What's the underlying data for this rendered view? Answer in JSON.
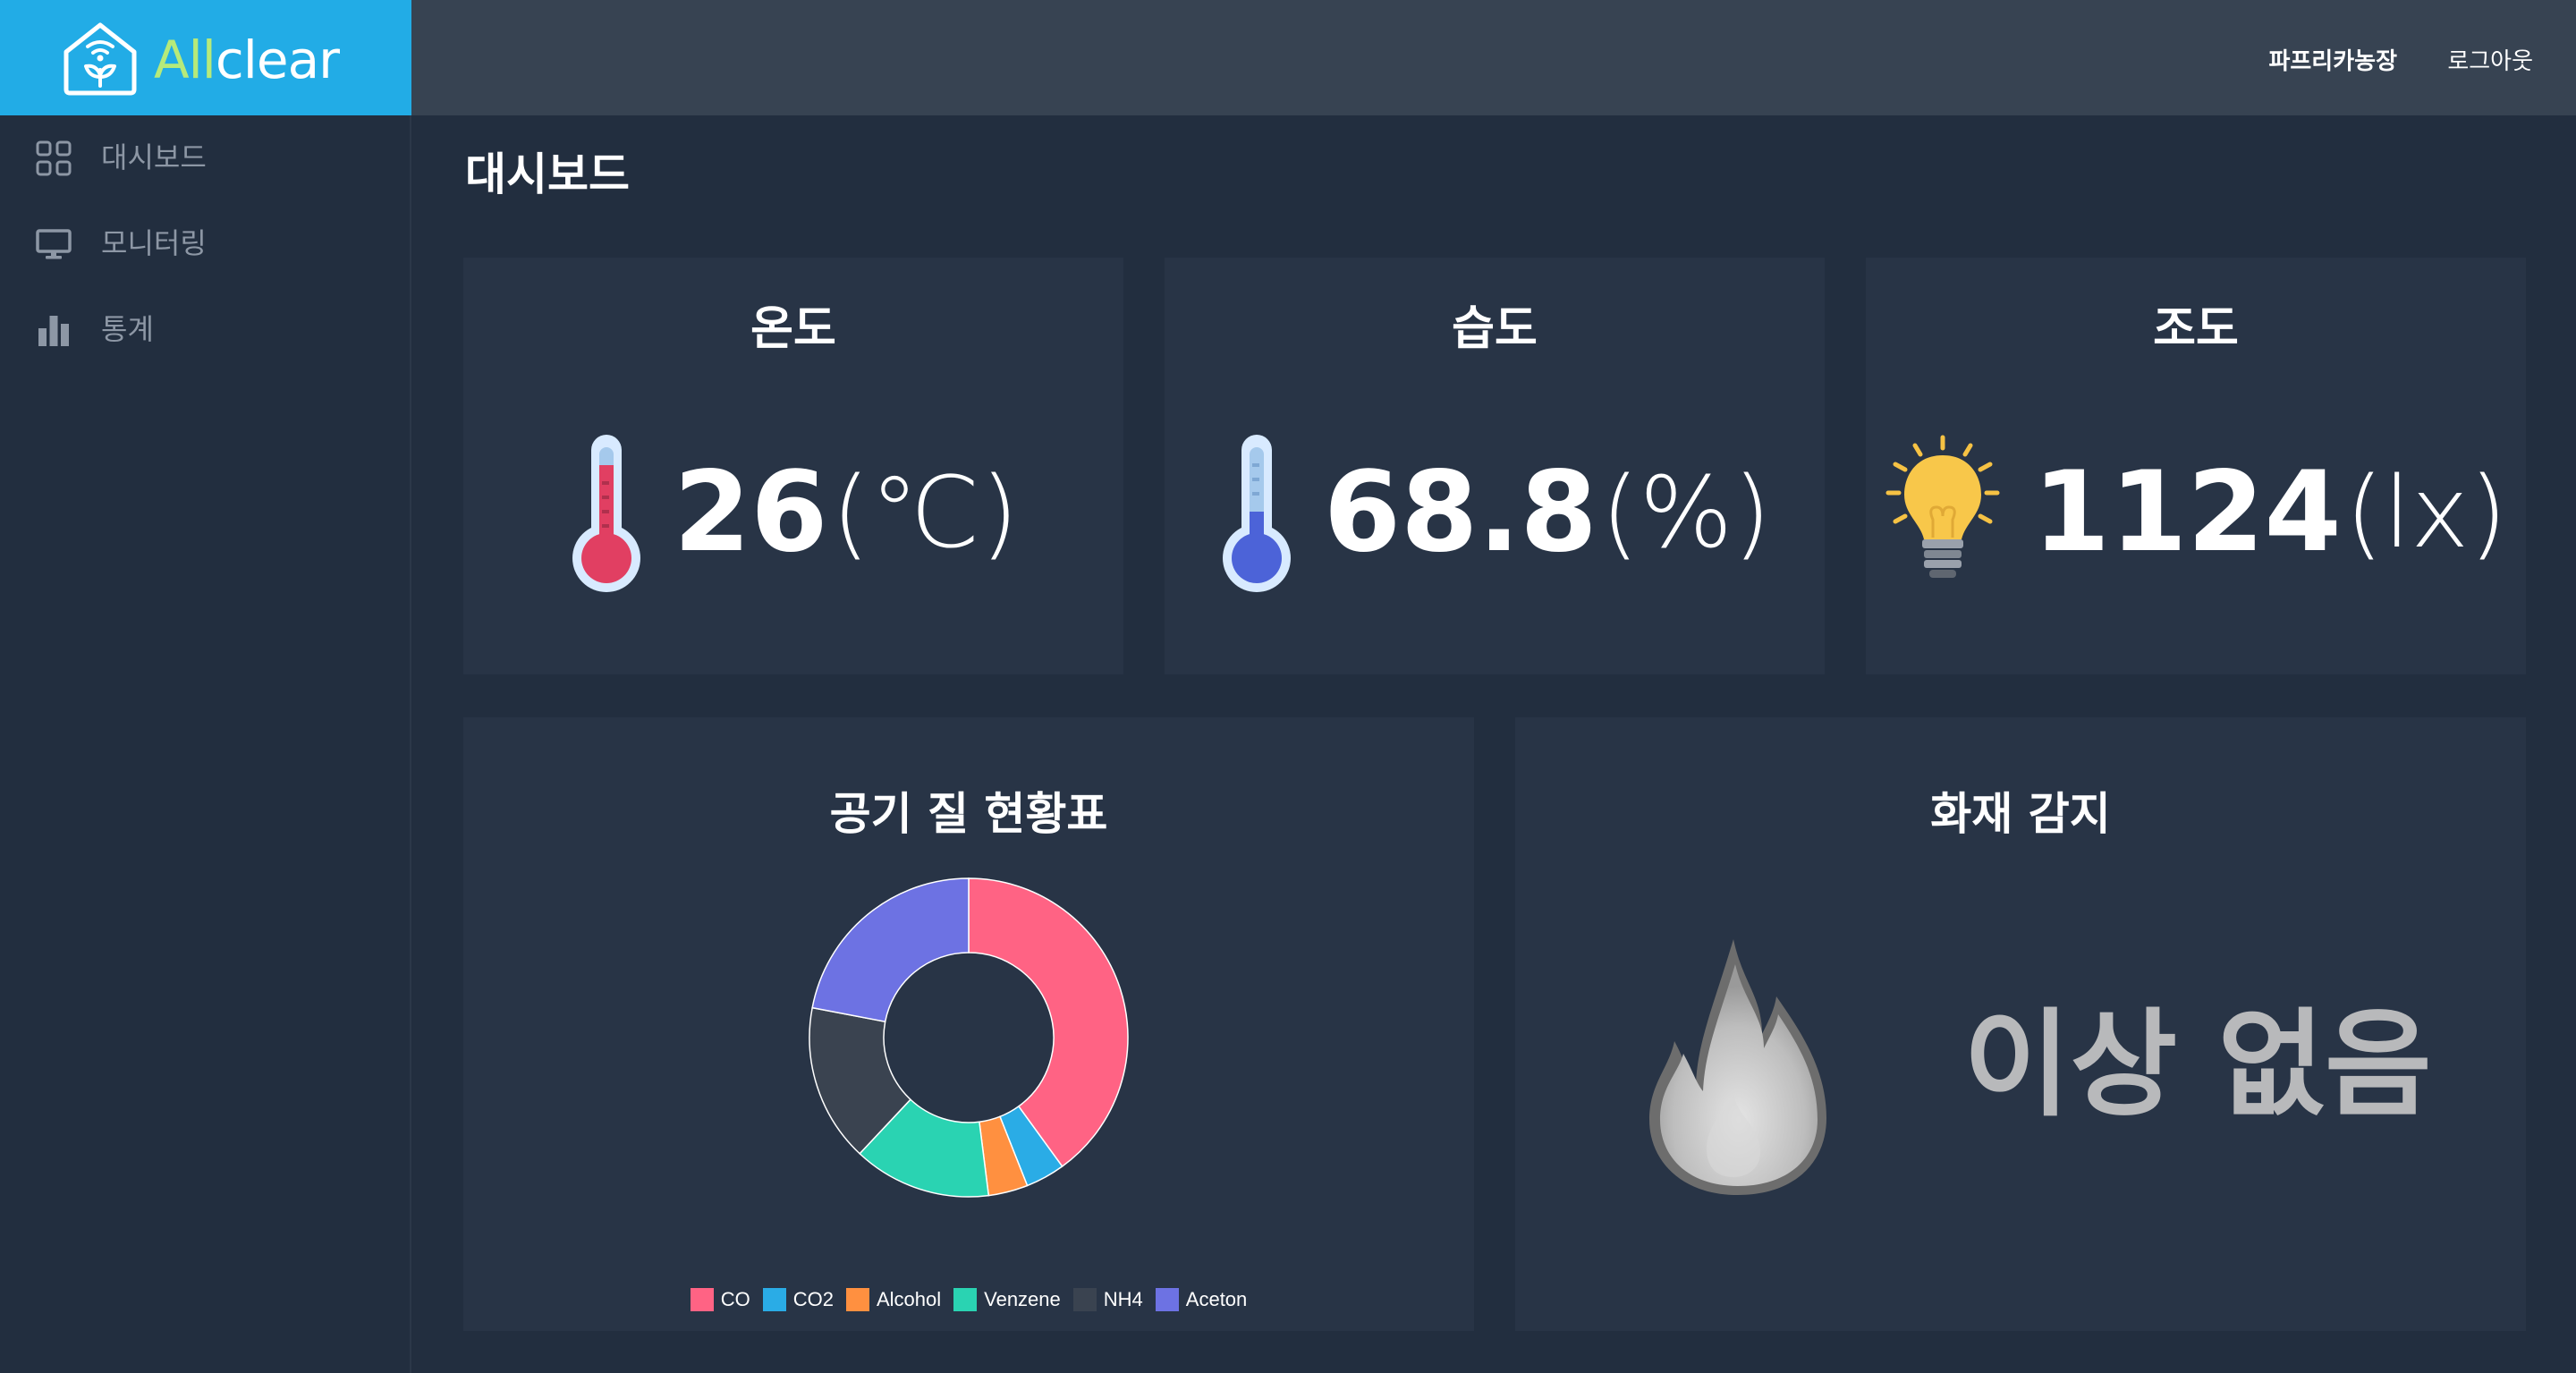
{
  "brand": {
    "name_part1": "All",
    "name_part2": "clear"
  },
  "header": {
    "farm_name": "파프리카농장",
    "logout_label": "로그아웃"
  },
  "sidebar": {
    "items": [
      {
        "label": "대시보드",
        "icon": "dashboard-grid-icon"
      },
      {
        "label": "모니터링",
        "icon": "monitor-icon"
      },
      {
        "label": "통계",
        "icon": "bar-chart-icon"
      }
    ]
  },
  "page": {
    "title": "대시보드"
  },
  "sensors": {
    "temperature": {
      "title": "온도",
      "value": "26",
      "unit": "(℃)",
      "icon": "thermometer-hot-icon"
    },
    "humidity": {
      "title": "습도",
      "value": "68.8",
      "unit": "(%)",
      "icon": "thermometer-cold-icon"
    },
    "illuminance": {
      "title": "조도",
      "value": "1124",
      "unit": "(lx)",
      "icon": "lightbulb-icon"
    }
  },
  "air_quality": {
    "title": "공기 질 현황표"
  },
  "fire": {
    "title": "화재 감지",
    "status": "이상 없음",
    "icon": "fire-icon"
  },
  "colors": {
    "brand": "#22ace6",
    "CO": "#ff6384",
    "CO2": "#36a2eb",
    "Alcohol": "#ff9f40",
    "Venzene": "#2ad3b2",
    "NH4": "#3a4350",
    "Aceton": "#6d72e3"
  },
  "chart_data": {
    "type": "pie",
    "donut": true,
    "title": "",
    "categories": [
      "CO",
      "CO2",
      "Alcohol",
      "Venzene",
      "NH4",
      "Aceton"
    ],
    "values": [
      40,
      4,
      4,
      14,
      16,
      22
    ],
    "colors": [
      "#ff6384",
      "#2aace6",
      "#ff9040",
      "#2ad3b2",
      "#3a4350",
      "#6d72e3"
    ],
    "legend": "bottom"
  }
}
